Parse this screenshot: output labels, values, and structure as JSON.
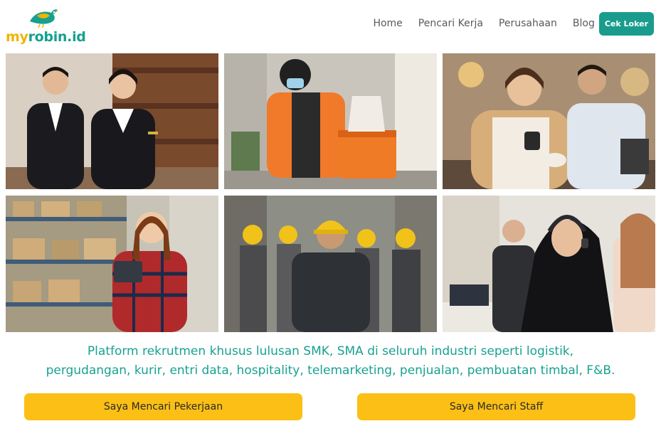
{
  "brand": {
    "logo_my": "my",
    "logo_rest": "robin.id"
  },
  "nav": {
    "home": "Home",
    "job_seekers": "Pencari Kerja",
    "companies": "Perusahaan",
    "blog": "Blog",
    "cta": "Cek Loker"
  },
  "photos": [
    {
      "icon": "hospitality-staff-photo"
    },
    {
      "icon": "courier-photo"
    },
    {
      "icon": "barista-photo"
    },
    {
      "icon": "warehouse-worker-photo"
    },
    {
      "icon": "construction-workers-photo"
    },
    {
      "icon": "call-center-photo"
    }
  ],
  "tagline": {
    "line1": "Platform rekrutmen khusus lulusan SMK, SMA di seluruh industri seperti logistik,",
    "line2": "pergudangan, kurir, entri data, hospitality, telemarketing, penjualan, pembuatan timbal, F&B."
  },
  "cta": {
    "job_seeker": "Saya Mencari Pekerjaan",
    "staff": "Saya Mencari Staff"
  },
  "colors": {
    "brand_teal": "#16a08f",
    "brand_yellow": "#f0b400",
    "cta_yellow": "#fbbf15",
    "nav_button": "#1a9c8c"
  }
}
